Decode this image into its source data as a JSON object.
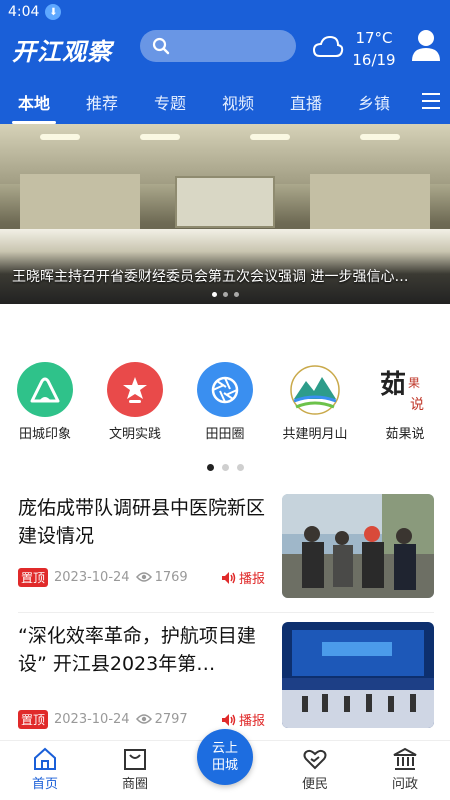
{
  "status": {
    "time": "4:04"
  },
  "header": {
    "logo": "开江观察",
    "weather": {
      "temp": "17°C",
      "range": "16/19"
    }
  },
  "tabs": [
    "本地",
    "推荐",
    "专题",
    "视频",
    "直播",
    "乡镇"
  ],
  "active_tab": "本地",
  "banner": {
    "title": "王晓晖主持召开省委财经委员会第五次会议强调 进一步强信心…",
    "slide_count": 3,
    "active_slide": 1
  },
  "shortcuts": [
    {
      "label": "田城印象",
      "color": "#2fc28a"
    },
    {
      "label": "文明实践",
      "color": "#e94a4a"
    },
    {
      "label": "田田圈",
      "color": "#3a8ff0"
    },
    {
      "label": "共建明月山",
      "color": "#ffffff"
    },
    {
      "label": "茹果说",
      "color": "#ffffff"
    }
  ],
  "shortcut_pages": 3,
  "news": [
    {
      "title": "庞佑成带队调研县中医院新区建设情况",
      "tag": "置顶",
      "date": "2023-10-24",
      "views": "1769",
      "action": "播报"
    },
    {
      "title": "“深化效率革命，护航项目建设” 开江县2023年第…",
      "tag": "置顶",
      "date": "2023-10-24",
      "views": "2797",
      "action": "播报"
    }
  ],
  "bottom_nav": {
    "home": "首页",
    "shop": "商圈",
    "center_line1": "云上",
    "center_line2": "田城",
    "service": "便民",
    "politics": "问政"
  },
  "colors": {
    "brand": "#1a5fd8",
    "accent_red": "#e02a2a"
  }
}
